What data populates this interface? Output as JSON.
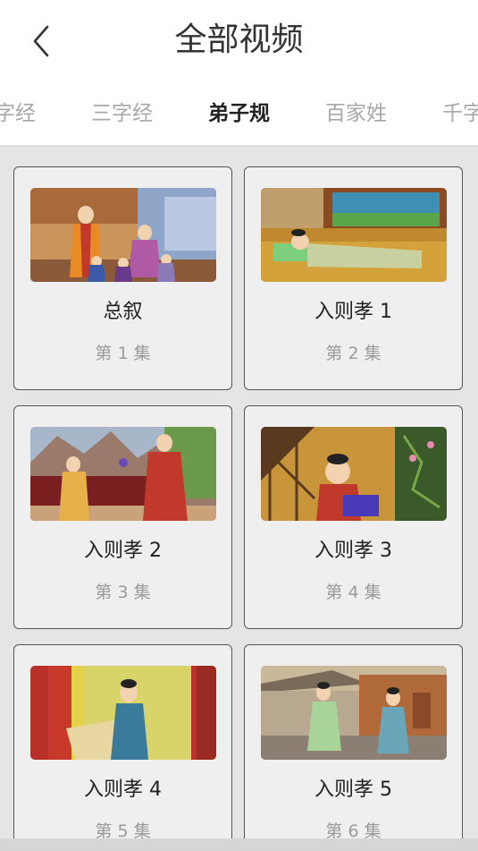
{
  "header": {
    "title": "全部视频",
    "back_icon": "chevron-left-icon"
  },
  "tabs": [
    {
      "label": "字经",
      "active": false
    },
    {
      "label": "三字经",
      "active": false
    },
    {
      "label": "弟子规",
      "active": true
    },
    {
      "label": "百家姓",
      "active": false
    },
    {
      "label": "千字",
      "active": false
    }
  ],
  "videos": [
    {
      "title": "总叙",
      "episode": "第 1 集"
    },
    {
      "title": "入则孝 1",
      "episode": "第 2 集"
    },
    {
      "title": "入则孝 2",
      "episode": "第 3 集"
    },
    {
      "title": "入则孝 3",
      "episode": "第 4 集"
    },
    {
      "title": "入则孝 4",
      "episode": "第 5 集"
    },
    {
      "title": "入则孝 5",
      "episode": "第 6 集"
    }
  ],
  "colors": {
    "active_tab": "#222222",
    "inactive_tab": "#a8a8a8",
    "content_bg": "#e5e5e5",
    "card_bg": "#efefef"
  }
}
